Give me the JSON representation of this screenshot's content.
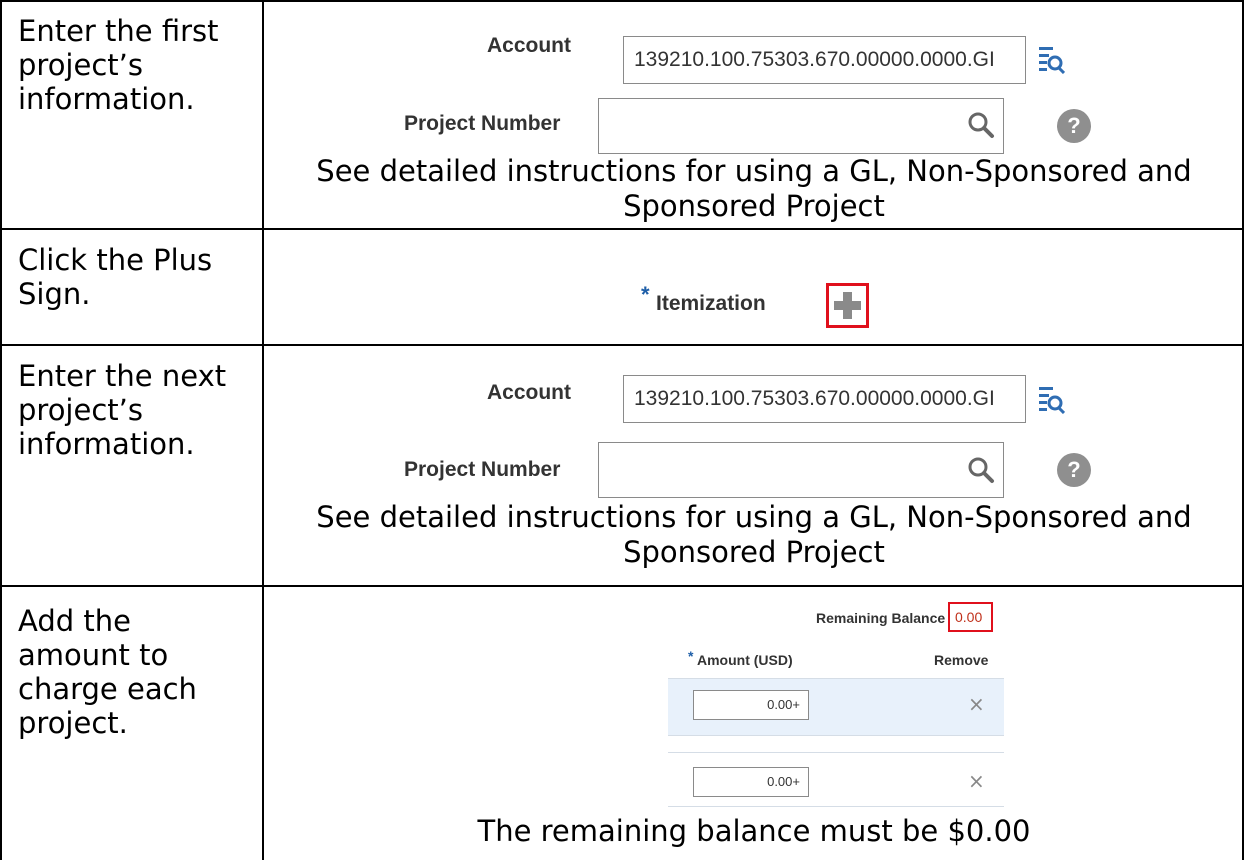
{
  "rows": [
    {
      "instruction": "Enter the first project’s information.",
      "account_label": "Account",
      "account_value": "139210.100.75303.670.00000.0000.GI",
      "project_label": "Project Number",
      "note": "See detailed instructions for using a GL, Non-Sponsored and Sponsored Project"
    },
    {
      "instruction": "Click the Plus Sign.",
      "itemization_label": "Itemization",
      "required_mark": "*"
    },
    {
      "instruction": "Enter the next project’s information.",
      "account_label": "Account",
      "account_value": "139210.100.75303.670.00000.0000.GI",
      "project_label": "Project Number",
      "note": "See detailed instructions for using a GL, Non-Sponsored and Sponsored Project"
    },
    {
      "instruction": "Add the amount to charge each project.",
      "remaining_label": "Remaining Balance",
      "remaining_value": "0.00",
      "amount_header": "Amount (USD)",
      "required_mark": "*",
      "remove_header": "Remove",
      "amounts": [
        "0.00+",
        "0.00+"
      ],
      "remove_glyph": "×",
      "note": "The remaining balance must be $0.00"
    }
  ],
  "icons": {
    "search": "search-icon",
    "account_lookup": "account-lookup-icon",
    "help": "help-icon",
    "plus": "plus-icon"
  },
  "help_glyph": "?",
  "colors": {
    "highlight_box": "#e0101c",
    "remaining_value": "#c0301a",
    "selected_row": "#e8f1fb",
    "lookup_icon": "#2f6db3"
  }
}
